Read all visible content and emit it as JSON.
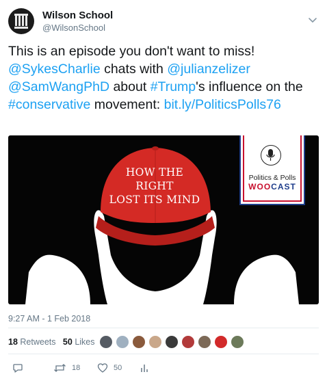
{
  "account": {
    "name": "Wilson School",
    "handle": "@WilsonSchool"
  },
  "tweet": {
    "segments": [
      {
        "text": "This is an episode you don't want to miss! ",
        "link": false
      },
      {
        "text": "@SykesCharlie",
        "link": true
      },
      {
        "text": " chats with ",
        "link": false
      },
      {
        "text": "@julianzelizer",
        "link": true
      },
      {
        "text": " ",
        "link": false
      },
      {
        "text": "@SamWangPhD",
        "link": true
      },
      {
        "text": " about ",
        "link": false
      },
      {
        "text": "#Trump",
        "link": true
      },
      {
        "text": "'s influence on the ",
        "link": false
      },
      {
        "text": "#conservative",
        "link": true
      },
      {
        "text": " movement: ",
        "link": false
      },
      {
        "text": "bit.ly/PoliticsPolls76",
        "link": true
      }
    ]
  },
  "media": {
    "cap_line1": "HOW THE RIGHT",
    "cap_line2": "LOST ITS MIND",
    "logo_title": "Politics & Polls",
    "logo_sub_a": "WOO",
    "logo_sub_b": "CAST"
  },
  "meta": {
    "timestamp": "9:27 AM - 1 Feb 2018",
    "retweets_count": "18",
    "retweets_label": "Retweets",
    "likes_count": "50",
    "likes_label": "Likes"
  },
  "actions": {
    "retweet_count": "18",
    "like_count": "50"
  },
  "colors": {
    "link": "#1da1f2",
    "secondary_text": "#657786",
    "hat_red": "#d42a25"
  },
  "icons": [
    "chevron-down-icon",
    "reply-icon",
    "retweet-icon",
    "like-icon",
    "analytics-icon"
  ]
}
